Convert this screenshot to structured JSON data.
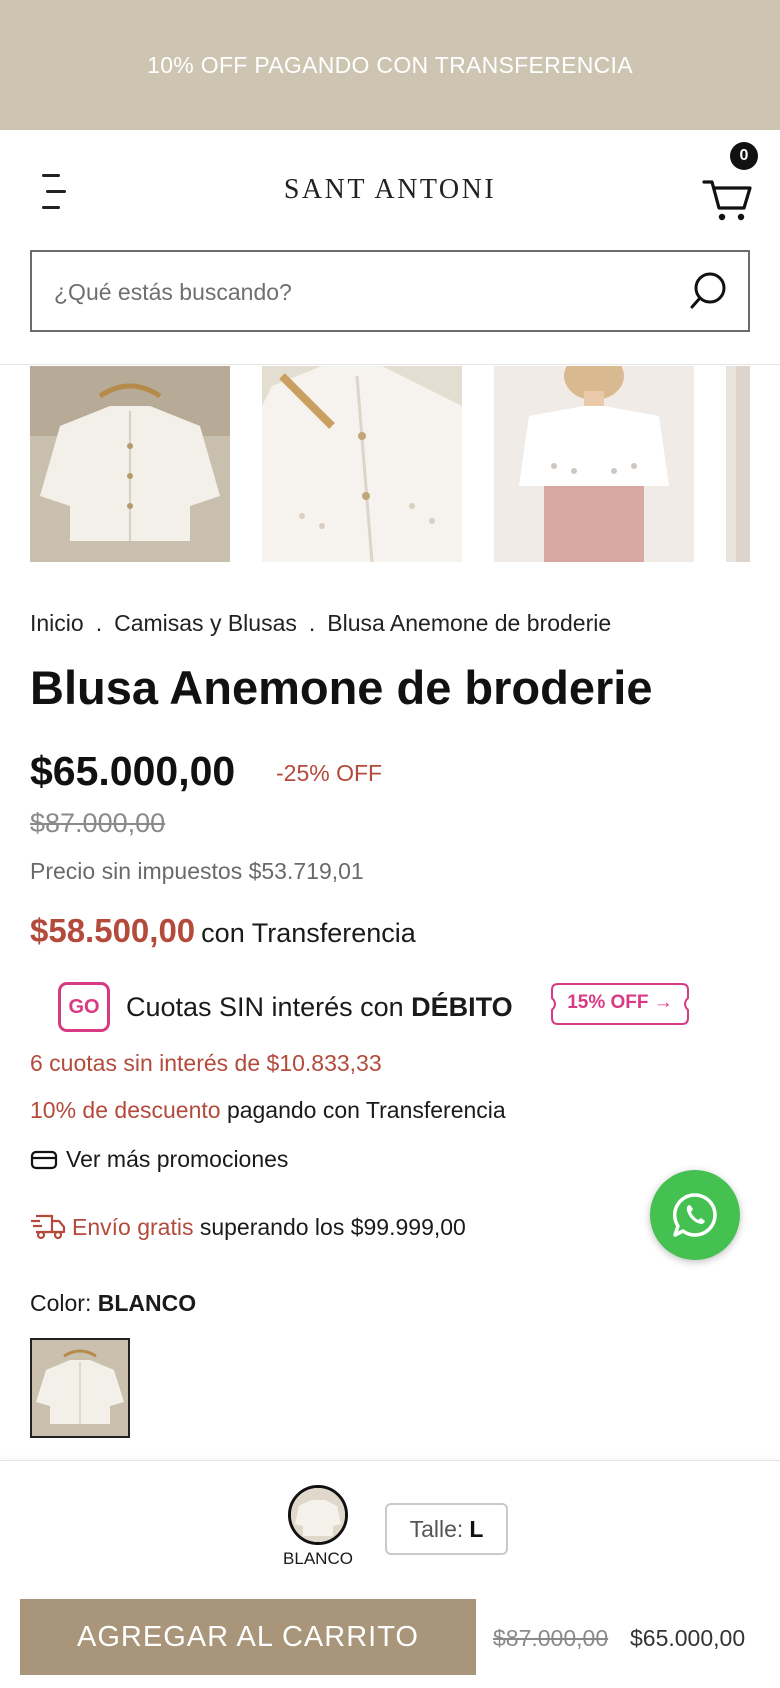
{
  "promo_bar": {
    "text": "10% OFF PAGANDO CON TRANSFERENCIA"
  },
  "header": {
    "brand": "SANT ANTONI",
    "cart_count": "0",
    "menu_icon": "hamburger-menu-icon",
    "cart_icon": "shopping-cart-icon"
  },
  "search": {
    "placeholder": "¿Qué estás buscando?",
    "icon": "search-icon"
  },
  "gallery": {
    "images": [
      "blusa-hanger-front",
      "blusa-detail-closeup",
      "blusa-model-photo",
      "blusa-partial"
    ]
  },
  "breadcrumb": {
    "items": [
      "Inicio",
      "Camisas y Blusas",
      "Blusa Anemone de broderie"
    ],
    "separator": "."
  },
  "product": {
    "title": "Blusa Anemone de broderie",
    "price": "$65.000,00",
    "discount": "-25% OFF",
    "old_price": "$87.000,00",
    "tax_price": "Precio sin impuestos $53.719,01",
    "transfer_price": "$58.500,00",
    "transfer_label": "con Transferencia"
  },
  "go_banner": {
    "logo": "GO",
    "text_prefix": "Cuotas SIN interés con",
    "text_bold": "DÉBITO",
    "tag": "15% OFF →"
  },
  "promotions": {
    "installments": "6 cuotas sin interés de $10.833,33",
    "transfer_discount_red": "10% de descuento",
    "transfer_discount_rest": "pagando con Transferencia",
    "more_label": "Ver más promociones",
    "more_icon": "credit-card-icon"
  },
  "shipping": {
    "red": "Envío gratis",
    "rest": "superando los $99.999,00",
    "icon": "delivery-truck-icon"
  },
  "whatsapp": {
    "icon": "whatsapp-icon",
    "color": "#45c152"
  },
  "variants": {
    "color_label": "Color:",
    "color_value": "BLANCO"
  },
  "sticky": {
    "swatch_label": "BLANCO",
    "size_label": "Talle:",
    "size_value": "L",
    "add_to_cart": "AGREGAR AL CARRITO",
    "old_price": "$87.000,00",
    "price": "$65.000,00"
  },
  "colors": {
    "promo_bg": "#cdc5b2",
    "accent_red": "#b34a3b",
    "go_pink": "#d93a84",
    "button_bg": "#a8957a"
  }
}
